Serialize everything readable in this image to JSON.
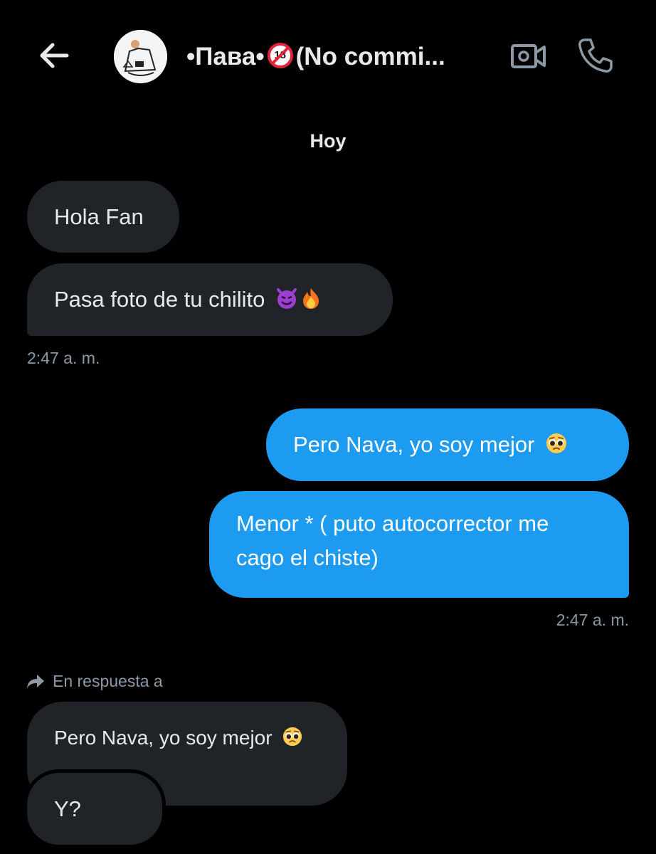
{
  "header": {
    "back_icon": "back-arrow-icon",
    "contact_name_pre": "•Пава•",
    "contact_badge": "18",
    "contact_name_post": "(No commi...",
    "video_icon": "video-call-icon",
    "call_icon": "phone-icon"
  },
  "day_label": "Hoy",
  "messages": [
    {
      "side": "in",
      "text": "Hola Fan"
    },
    {
      "side": "in",
      "text": "Pasa foto de tu chilito",
      "emoji": [
        "smiling-devil",
        "fire"
      ]
    },
    {
      "side": "in_time",
      "text": "2:47 a. m."
    },
    {
      "side": "out",
      "text": "Pero Nava, yo soy mejor",
      "emoji": [
        "pleading-face"
      ]
    },
    {
      "side": "out",
      "text_line1": "Menor * ( puto autocorrector me",
      "text_line2": "cago el chiste)"
    },
    {
      "side": "out_time",
      "text": "2:47 a. m."
    }
  ],
  "reply": {
    "label": "En respuesta a",
    "quoted_text": "Pero Nava, yo soy mejor",
    "quoted_emoji": "pleading-face",
    "message": "Y?"
  },
  "colors": {
    "background": "#000000",
    "incoming_bubble": "#202327",
    "outgoing_bubble": "#1d9bf0",
    "muted_text": "#8b98a5"
  }
}
